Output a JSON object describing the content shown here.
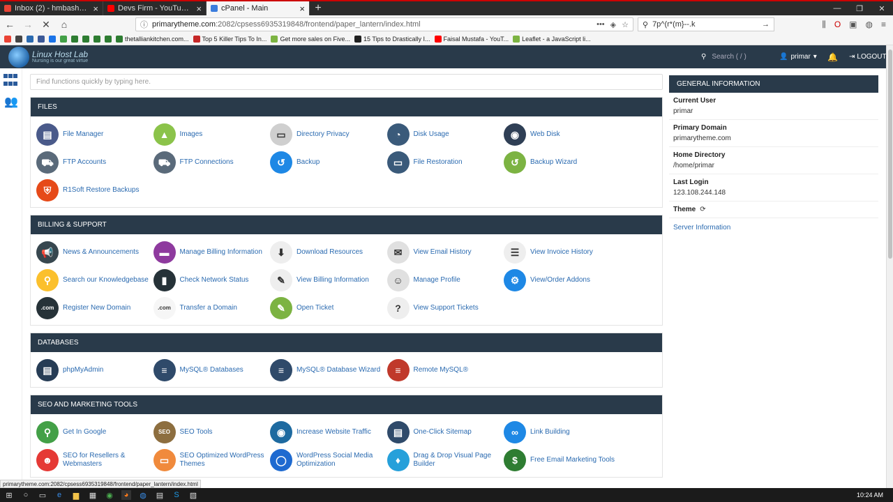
{
  "browser": {
    "tabs": [
      {
        "label": "Inbox (2) - hmbashar@gmail.c...",
        "icon": "gmail-icon",
        "color": "#ea4335"
      },
      {
        "label": "Devs Firm - YouTube - YouTub...",
        "icon": "youtube-icon",
        "color": "#ff0000"
      },
      {
        "label": "cPanel - Main",
        "icon": "cpanel-icon",
        "color": "#3b7ddd"
      }
    ],
    "url_host": "primarytheme.com",
    "url_path": ":2082/cpsess6935319848/frontend/paper_lantern/index.html",
    "search_text": "7p^(r*(m}--.k",
    "bookmarks": [
      {
        "label": "",
        "color": "#ea4335"
      },
      {
        "label": "",
        "color": "#444"
      },
      {
        "label": "",
        "color": "#2a6ab0"
      },
      {
        "label": "",
        "color": "#3b5998"
      },
      {
        "label": "",
        "color": "#1a73e8"
      },
      {
        "label": "",
        "color": "#43a047"
      },
      {
        "label": "",
        "color": "#2e7d32"
      },
      {
        "label": "",
        "color": "#2e7d32"
      },
      {
        "label": "",
        "color": "#2e7d32"
      },
      {
        "label": "",
        "color": "#2e7d32"
      },
      {
        "label": "thetalliankitchen.com...",
        "color": "#2e7d32"
      },
      {
        "label": "Top 5 Killer Tips To In...",
        "color": "#c62828"
      },
      {
        "label": "Get more sales on Five...",
        "color": "#7cb342"
      },
      {
        "label": "15 Tips to Drastically I...",
        "color": "#212121"
      },
      {
        "label": "Faisal Mustafa - YouT...",
        "color": "#ff0000"
      },
      {
        "label": "Leaflet - a JavaScript li...",
        "color": "#7cb342"
      }
    ]
  },
  "header": {
    "brand_name": "Linux Host Lab",
    "brand_tagline": "Nursing is our great virtue",
    "search_placeholder": "Search ( / )",
    "user": "primar",
    "logout": "LOGOUT"
  },
  "quick_search_placeholder": "Find functions quickly by typing here.",
  "sections": [
    {
      "title": "FILES",
      "items": [
        {
          "label": "File Manager",
          "icon": "file-manager-icon",
          "color": "#4a5a8a",
          "glyph": "▤"
        },
        {
          "label": "Images",
          "icon": "images-icon",
          "color": "#8bc34a",
          "glyph": "▲"
        },
        {
          "label": "Directory Privacy",
          "icon": "directory-privacy-icon",
          "color": "#cfcfcf",
          "glyph": "▭"
        },
        {
          "label": "Disk Usage",
          "icon": "disk-usage-icon",
          "color": "#3a5a7a",
          "glyph": "◔"
        },
        {
          "label": "Web Disk",
          "icon": "web-disk-icon",
          "color": "#2f3f55",
          "glyph": "◉"
        },
        {
          "label": "FTP Accounts",
          "icon": "ftp-accounts-icon",
          "color": "#5a6a7a",
          "glyph": "⛟"
        },
        {
          "label": "FTP Connections",
          "icon": "ftp-connections-icon",
          "color": "#5a6a7a",
          "glyph": "⛟"
        },
        {
          "label": "Backup",
          "icon": "backup-icon",
          "color": "#1e88e5",
          "glyph": "↺"
        },
        {
          "label": "File Restoration",
          "icon": "file-restoration-icon",
          "color": "#3a5a7a",
          "glyph": "▭"
        },
        {
          "label": "Backup Wizard",
          "icon": "backup-wizard-icon",
          "color": "#7cb342",
          "glyph": "↺"
        },
        {
          "label": "R1Soft Restore Backups",
          "icon": "r1soft-icon",
          "color": "#e64a19",
          "glyph": "⛨"
        }
      ]
    },
    {
      "title": "BILLING & SUPPORT",
      "items": [
        {
          "label": "News & Announcements",
          "icon": "news-icon",
          "color": "#37474f",
          "glyph": "📢"
        },
        {
          "label": "Manage Billing Information",
          "icon": "billing-info-icon",
          "color": "#8e3a9e",
          "glyph": "▬"
        },
        {
          "label": "Download Resources",
          "icon": "download-icon",
          "color": "#eeeeee",
          "glyph": "⬇"
        },
        {
          "label": "View Email History",
          "icon": "email-history-icon",
          "color": "#e0e0e0",
          "glyph": "✉"
        },
        {
          "label": "View Invoice History",
          "icon": "invoice-history-icon",
          "color": "#eeeeee",
          "glyph": "☰"
        },
        {
          "label": "Search our Knowledgebase",
          "icon": "knowledgebase-icon",
          "color": "#fbc02d",
          "glyph": "⚲"
        },
        {
          "label": "Check Network Status",
          "icon": "network-status-icon",
          "color": "#263238",
          "glyph": "▮"
        },
        {
          "label": "View Billing Information",
          "icon": "view-billing-icon",
          "color": "#eeeeee",
          "glyph": "✎"
        },
        {
          "label": "Manage Profile",
          "icon": "profile-icon",
          "color": "#e0e0e0",
          "glyph": "☺"
        },
        {
          "label": "View/Order Addons",
          "icon": "addons-icon",
          "color": "#1e88e5",
          "glyph": "⚙"
        },
        {
          "label": "Register New Domain",
          "icon": "register-domain-icon",
          "color": "#263238",
          "glyph": ".com"
        },
        {
          "label": "Transfer a Domain",
          "icon": "transfer-domain-icon",
          "color": "#f6f6f6",
          "glyph": ".com"
        },
        {
          "label": "Open Ticket",
          "icon": "open-ticket-icon",
          "color": "#7cb342",
          "glyph": "✎"
        },
        {
          "label": "View Support Tickets",
          "icon": "support-tickets-icon",
          "color": "#eeeeee",
          "glyph": "?"
        }
      ]
    },
    {
      "title": "DATABASES",
      "items": [
        {
          "label": "phpMyAdmin",
          "icon": "phpmyadmin-icon",
          "color": "#263c55",
          "glyph": "▤"
        },
        {
          "label": "MySQL® Databases",
          "icon": "mysql-databases-icon",
          "color": "#2f4a6a",
          "glyph": "≡"
        },
        {
          "label": "MySQL® Database Wizard",
          "icon": "mysql-wizard-icon",
          "color": "#2f4a6a",
          "glyph": "≡"
        },
        {
          "label": "Remote MySQL®",
          "icon": "remote-mysql-icon",
          "color": "#c0392b",
          "glyph": "≡"
        }
      ]
    },
    {
      "title": "SEO AND MARKETING TOOLS",
      "items": [
        {
          "label": "Get In Google",
          "icon": "get-in-google-icon",
          "color": "#43a047",
          "glyph": "⚲"
        },
        {
          "label": "SEO Tools",
          "icon": "seo-tools-icon",
          "color": "#8d6e3f",
          "glyph": "SEO"
        },
        {
          "label": "Increase Website Traffic",
          "icon": "website-traffic-icon",
          "color": "#1e6aa0",
          "glyph": "◉"
        },
        {
          "label": "One-Click Sitemap",
          "icon": "sitemap-icon",
          "color": "#2f4a6a",
          "glyph": "▤"
        },
        {
          "label": "Link Building",
          "icon": "link-building-icon",
          "color": "#1e88e5",
          "glyph": "∞"
        },
        {
          "label": "SEO for Resellers & Webmasters",
          "icon": "seo-resellers-icon",
          "color": "#e53935",
          "glyph": "☻"
        },
        {
          "label": "SEO Optimized WordPress Themes",
          "icon": "wp-themes-icon",
          "color": "#f08a3c",
          "glyph": "▭"
        },
        {
          "label": "WordPress Social Media Optimization",
          "icon": "wp-social-icon",
          "color": "#1e6ad0",
          "glyph": "◯"
        },
        {
          "label": "Drag & Drop Visual Page Builder",
          "icon": "page-builder-icon",
          "color": "#26a0da",
          "glyph": "♦"
        },
        {
          "label": "Free Email Marketing Tools",
          "icon": "email-marketing-icon",
          "color": "#2e7d32",
          "glyph": "$"
        }
      ]
    }
  ],
  "general_info": {
    "title": "GENERAL INFORMATION",
    "rows": [
      {
        "key": "Current User",
        "value": "primar"
      },
      {
        "key": "Primary Domain",
        "value": "primarytheme.com"
      },
      {
        "key": "Home Directory",
        "value": "/home/primar"
      },
      {
        "key": "Last Login",
        "value": "123.108.244.148"
      },
      {
        "key": "Theme",
        "value": "⟳"
      }
    ],
    "link": "Server Information"
  },
  "status_url": "primarytheme.com:2082/cpsess6935319848/frontend/paper_lantern/index.html",
  "clock": "10:24 AM"
}
